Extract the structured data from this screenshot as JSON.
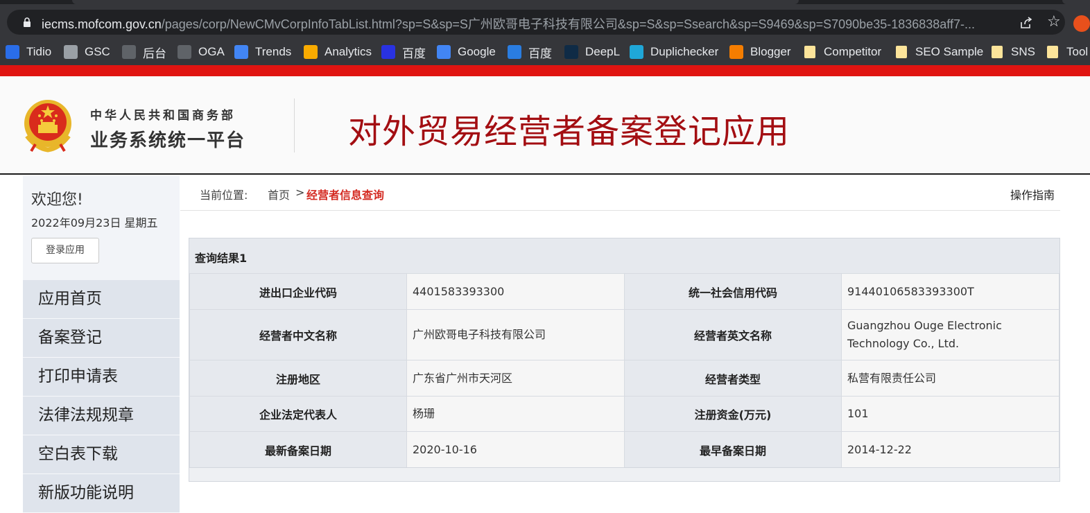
{
  "browser": {
    "url_host": "iecms.mofcom.gov.cn",
    "url_path": "/pages/corp/NewCMvCorpInfoTabList.html?sp=S&sp=S广州欧哥电子科技有限公司&sp=S&sp=Ssearch&sp=S9469&sp=S7090be35-1836838aff7-..."
  },
  "bookmarks": [
    {
      "label": "Tidio",
      "icon": "tidio-icon",
      "color": "#2a6de8"
    },
    {
      "label": "GSC",
      "icon": "gsc-icon",
      "color": "#9aa0a6"
    },
    {
      "label": "后台",
      "icon": "backend-icon",
      "color": "#5f6368"
    },
    {
      "label": "OGA",
      "icon": "oga-icon",
      "color": "#5f6368"
    },
    {
      "label": "Trends",
      "icon": "trends-icon",
      "color": "#4285f4"
    },
    {
      "label": "Analytics",
      "icon": "analytics-icon",
      "color": "#f9ab00"
    },
    {
      "label": "百度",
      "icon": "baidu-icon",
      "color": "#2932e1"
    },
    {
      "label": "Google",
      "icon": "google-translate-icon",
      "color": "#4285f4"
    },
    {
      "label": "百度",
      "icon": "baidu-translate-icon",
      "color": "#2a7de1"
    },
    {
      "label": "DeepL",
      "icon": "deepl-icon",
      "color": "#0f2b46"
    },
    {
      "label": "Duplichecker",
      "icon": "duplichecker-icon",
      "color": "#1fa7d8"
    },
    {
      "label": "Blogger",
      "icon": "blogger-icon",
      "color": "#f57d00"
    },
    {
      "label": "Competitor",
      "icon": "folder-icon",
      "color": "#fce49a"
    },
    {
      "label": "SEO Sample",
      "icon": "folder-icon",
      "color": "#fce49a"
    },
    {
      "label": "SNS",
      "icon": "folder-icon",
      "color": "#fce49a"
    },
    {
      "label": "Tool",
      "icon": "folder-icon",
      "color": "#fce49a"
    }
  ],
  "header": {
    "ministry": "中华人民共和国商务部",
    "platform": "业务系统统一平台",
    "app_title": "对外贸易经营者备案登记应用",
    "accent_color": "#e01411"
  },
  "sidebar": {
    "welcome": "欢迎您!",
    "date": "2022年09月23日 星期五",
    "login_button": "登录应用",
    "items": [
      {
        "label": "应用首页"
      },
      {
        "label": "备案登记"
      },
      {
        "label": "打印申请表"
      },
      {
        "label": "法律法规规章"
      },
      {
        "label": "空白表下载"
      },
      {
        "label": "新版功能说明"
      }
    ]
  },
  "breadcrumb": {
    "label": "当前位置:",
    "home": "首页",
    "separator": ">",
    "current": "经营者信息查询",
    "guide": "操作指南"
  },
  "result": {
    "title": "查询结果1",
    "rows": [
      {
        "label1": "进出口企业代码",
        "value1": "4401583393300",
        "label2": "统一社会信用代码",
        "value2": "91440106583393300T"
      },
      {
        "label1": "经营者中文名称",
        "value1": "广州欧哥电子科技有限公司",
        "label2": "经营者英文名称",
        "value2": "Guangzhou Ouge Electronic Technology Co., Ltd."
      },
      {
        "label1": "注册地区",
        "value1": "广东省广州市天河区",
        "label2": "经营者类型",
        "value2": "私营有限责任公司"
      },
      {
        "label1": "企业法定代表人",
        "value1": "杨珊",
        "label2": "注册资金(万元)",
        "value2": "101"
      },
      {
        "label1": "最新备案日期",
        "value1": "2020-10-16",
        "label2": "最早备案日期",
        "value2": "2014-12-22"
      }
    ]
  }
}
